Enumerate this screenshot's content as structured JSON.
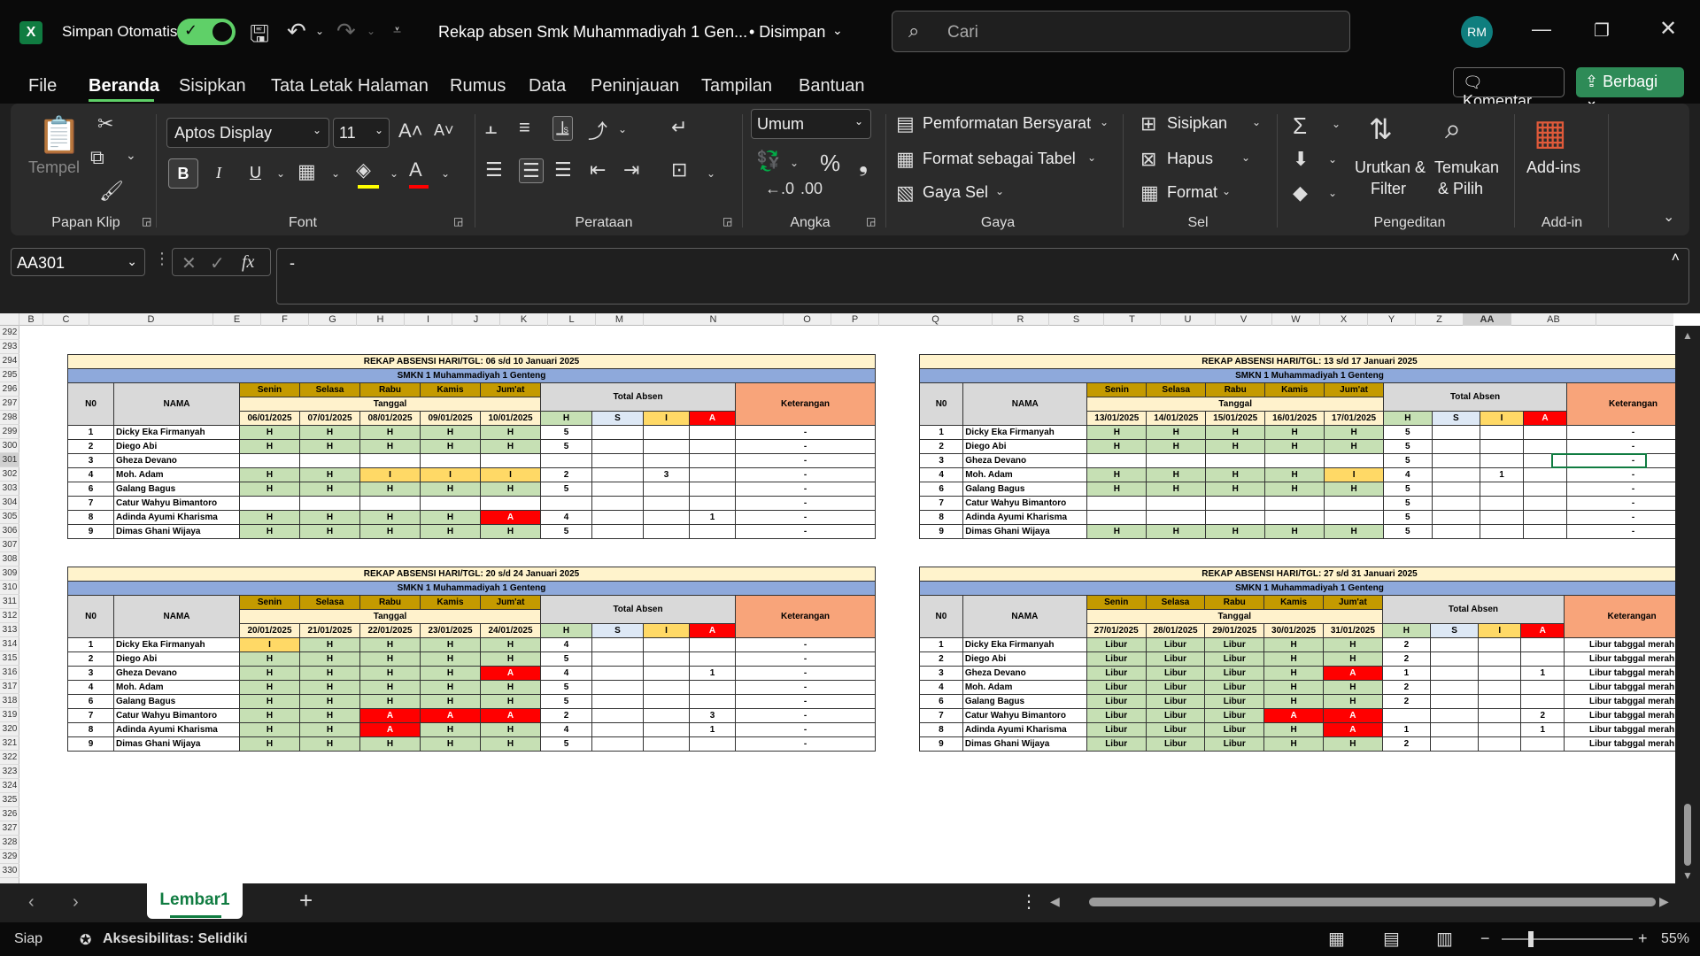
{
  "titlebar": {
    "autosave_label": "Simpan Otomatis",
    "doc_title": "Rekap absen Smk Muhammadiyah 1 Gen...",
    "saved_status": "• Disimpan",
    "search_placeholder": "Cari",
    "avatar_initials": "RM"
  },
  "menu": {
    "tabs": [
      "File",
      "Beranda",
      "Sisipkan",
      "Tata Letak Halaman",
      "Rumus",
      "Data",
      "Peninjauan",
      "Tampilan",
      "Bantuan"
    ],
    "comment_label": "Komentar",
    "share_label": "Berbagi"
  },
  "ribbon": {
    "clipboard": {
      "paste": "Tempel",
      "label": "Papan Klip"
    },
    "font": {
      "name": "Aptos Display",
      "size": "11",
      "label": "Font",
      "bold": "B",
      "italic": "I",
      "underline": "U"
    },
    "alignment": {
      "label": "Perataan"
    },
    "number": {
      "format": "Umum",
      "label": "Angka"
    },
    "styles": {
      "conditional": "Pemformatan Bersyarat",
      "format_table": "Format sebagai Tabel",
      "cell_styles": "Gaya Sel",
      "label": "Gaya"
    },
    "cells": {
      "insert": "Sisipkan",
      "delete": "Hapus",
      "format": "Format",
      "label": "Sel"
    },
    "editing": {
      "sort_filter_1": "Urutkan &",
      "sort_filter_2": "Filter",
      "find_1": "Temukan",
      "find_2": "& Pilih",
      "label": "Pengeditan"
    },
    "addins": {
      "button": "Add-ins",
      "label": "Add-in"
    }
  },
  "formula": {
    "namebox": "AA301",
    "content": "-"
  },
  "columns": [
    "B",
    "C",
    "D",
    "E",
    "F",
    "G",
    "H",
    "I",
    "J",
    "K",
    "L",
    "M",
    "N",
    "O",
    "P",
    "Q",
    "R",
    "S",
    "T",
    "U",
    "V",
    "W",
    "X",
    "Y",
    "Z",
    "AA",
    "AB"
  ],
  "rows": [
    "292",
    "293",
    "294",
    "295",
    "296",
    "297",
    "298",
    "299",
    "300",
    "301",
    "302",
    "303",
    "304",
    "305",
    "306",
    "307",
    "308",
    "309",
    "310",
    "311",
    "312",
    "313",
    "314",
    "315",
    "316",
    "317",
    "318",
    "319",
    "320",
    "321",
    "322",
    "323",
    "324",
    "325",
    "326",
    "327",
    "328",
    "329",
    "330"
  ],
  "tables": [
    {
      "title": "REKAP ABSENSI HARI/TGL: 06 s/d 10 Januari 2025",
      "school": "SMKN 1 Muhammadiyah 1 Genteng",
      "days": [
        "Senin",
        "Selasa",
        "Rabu",
        "Kamis",
        "Jum'at"
      ],
      "dates": [
        "06/01/2025",
        "07/01/2025",
        "08/01/2025",
        "09/01/2025",
        "10/01/2025"
      ],
      "rows": [
        {
          "no": "1",
          "name": "Dicky Eka Firmanyah",
          "att": [
            "H",
            "H",
            "H",
            "H",
            "H"
          ],
          "h": "5",
          "s": "",
          "i": "",
          "a": "",
          "ket": "-"
        },
        {
          "no": "2",
          "name": "Diego Abi",
          "att": [
            "H",
            "H",
            "H",
            "H",
            "H"
          ],
          "h": "5",
          "s": "",
          "i": "",
          "a": "",
          "ket": "-"
        },
        {
          "no": "3",
          "name": "Gheza Devano",
          "att": [
            "",
            "",
            "",
            "",
            ""
          ],
          "h": "",
          "s": "",
          "i": "",
          "a": "",
          "ket": "-"
        },
        {
          "no": "4",
          "name": "Moh. Adam",
          "att": [
            "H",
            "H",
            "I",
            "I",
            "I"
          ],
          "h": "2",
          "s": "",
          "i": "3",
          "a": "",
          "ket": "-"
        },
        {
          "no": "6",
          "name": "Galang Bagus",
          "att": [
            "H",
            "H",
            "H",
            "H",
            "H"
          ],
          "h": "5",
          "s": "",
          "i": "",
          "a": "",
          "ket": "-"
        },
        {
          "no": "7",
          "name": "Catur Wahyu Bimantoro",
          "att": [
            "",
            "",
            "",
            "",
            ""
          ],
          "h": "",
          "s": "",
          "i": "",
          "a": "",
          "ket": "-"
        },
        {
          "no": "8",
          "name": "Adinda Ayumi Kharisma",
          "att": [
            "H",
            "H",
            "H",
            "H",
            "A"
          ],
          "h": "4",
          "s": "",
          "i": "",
          "a": "1",
          "ket": "-"
        },
        {
          "no": "9",
          "name": "Dimas Ghani Wijaya",
          "att": [
            "H",
            "H",
            "H",
            "H",
            "H"
          ],
          "h": "5",
          "s": "",
          "i": "",
          "a": "",
          "ket": "-"
        }
      ]
    },
    {
      "title": "REKAP ABSENSI HARI/TGL: 13 s/d 17 Januari 2025",
      "school": "SMKN 1 Muhammadiyah 1 Genteng",
      "days": [
        "Senin",
        "Selasa",
        "Rabu",
        "Kamis",
        "Jum'at"
      ],
      "dates": [
        "13/01/2025",
        "14/01/2025",
        "15/01/2025",
        "16/01/2025",
        "17/01/2025"
      ],
      "rows": [
        {
          "no": "1",
          "name": "Dicky Eka Firmanyah",
          "att": [
            "H",
            "H",
            "H",
            "H",
            "H"
          ],
          "h": "5",
          "s": "",
          "i": "",
          "a": "",
          "ket": "-"
        },
        {
          "no": "2",
          "name": "Diego Abi",
          "att": [
            "H",
            "H",
            "H",
            "H",
            "H"
          ],
          "h": "5",
          "s": "",
          "i": "",
          "a": "",
          "ket": "-"
        },
        {
          "no": "3",
          "name": "Gheza Devano",
          "att": [
            "",
            "",
            "",
            "",
            ""
          ],
          "h": "5",
          "s": "",
          "i": "",
          "a": "",
          "ket": "-"
        },
        {
          "no": "4",
          "name": "Moh. Adam",
          "att": [
            "H",
            "H",
            "H",
            "H",
            "I"
          ],
          "h": "4",
          "s": "",
          "i": "1",
          "a": "",
          "ket": "-"
        },
        {
          "no": "6",
          "name": "Galang Bagus",
          "att": [
            "H",
            "H",
            "H",
            "H",
            "H"
          ],
          "h": "5",
          "s": "",
          "i": "",
          "a": "",
          "ket": "-"
        },
        {
          "no": "7",
          "name": "Catur Wahyu Bimantoro",
          "att": [
            "",
            "",
            "",
            "",
            ""
          ],
          "h": "5",
          "s": "",
          "i": "",
          "a": "",
          "ket": "-"
        },
        {
          "no": "8",
          "name": "Adinda Ayumi Kharisma",
          "att": [
            "",
            "",
            "",
            "",
            ""
          ],
          "h": "5",
          "s": "",
          "i": "",
          "a": "",
          "ket": "-"
        },
        {
          "no": "9",
          "name": "Dimas Ghani Wijaya",
          "att": [
            "H",
            "H",
            "H",
            "H",
            "H"
          ],
          "h": "5",
          "s": "",
          "i": "",
          "a": "",
          "ket": "-"
        }
      ]
    },
    {
      "title": "REKAP ABSENSI HARI/TGL: 20 s/d 24 Januari 2025",
      "school": "SMKN 1 Muhammadiyah 1 Genteng",
      "days": [
        "Senin",
        "Selasa",
        "Rabu",
        "Kamis",
        "Jum'at"
      ],
      "dates": [
        "20/01/2025",
        "21/01/2025",
        "22/01/2025",
        "23/01/2025",
        "24/01/2025"
      ],
      "rows": [
        {
          "no": "1",
          "name": "Dicky Eka Firmanyah",
          "att": [
            "I",
            "H",
            "H",
            "H",
            "H"
          ],
          "h": "4",
          "s": "",
          "i": "",
          "a": "",
          "ket": "-"
        },
        {
          "no": "2",
          "name": "Diego Abi",
          "att": [
            "H",
            "H",
            "H",
            "H",
            "H"
          ],
          "h": "5",
          "s": "",
          "i": "",
          "a": "",
          "ket": "-"
        },
        {
          "no": "3",
          "name": "Gheza Devano",
          "att": [
            "H",
            "H",
            "H",
            "H",
            "A"
          ],
          "h": "4",
          "s": "",
          "i": "",
          "a": "1",
          "ket": "-"
        },
        {
          "no": "4",
          "name": "Moh. Adam",
          "att": [
            "H",
            "H",
            "H",
            "H",
            "H"
          ],
          "h": "5",
          "s": "",
          "i": "",
          "a": "",
          "ket": "-"
        },
        {
          "no": "6",
          "name": "Galang Bagus",
          "att": [
            "H",
            "H",
            "H",
            "H",
            "H"
          ],
          "h": "5",
          "s": "",
          "i": "",
          "a": "",
          "ket": "-"
        },
        {
          "no": "7",
          "name": "Catur Wahyu Bimantoro",
          "att": [
            "H",
            "H",
            "A",
            "A",
            "A"
          ],
          "h": "2",
          "s": "",
          "i": "",
          "a": "3",
          "ket": "-"
        },
        {
          "no": "8",
          "name": "Adinda Ayumi Kharisma",
          "att": [
            "H",
            "H",
            "A",
            "H",
            "H"
          ],
          "h": "4",
          "s": "",
          "i": "",
          "a": "1",
          "ket": "-"
        },
        {
          "no": "9",
          "name": "Dimas Ghani Wijaya",
          "att": [
            "H",
            "H",
            "H",
            "H",
            "H"
          ],
          "h": "5",
          "s": "",
          "i": "",
          "a": "",
          "ket": "-"
        }
      ]
    },
    {
      "title": "REKAP ABSENSI HARI/TGL: 27 s/d 31 Januari 2025",
      "school": "SMKN 1 Muhammadiyah 1 Genteng",
      "days": [
        "Senin",
        "Selasa",
        "Rabu",
        "Kamis",
        "Jum'at"
      ],
      "dates": [
        "27/01/2025",
        "28/01/2025",
        "29/01/2025",
        "30/01/2025",
        "31/01/2025"
      ],
      "rows": [
        {
          "no": "1",
          "name": "Dicky Eka Firmanyah",
          "att": [
            "Libur",
            "Libur",
            "Libur",
            "H",
            "H"
          ],
          "h": "2",
          "s": "",
          "i": "",
          "a": "",
          "ket": "Libur tabggal merah"
        },
        {
          "no": "2",
          "name": "Diego Abi",
          "att": [
            "Libur",
            "Libur",
            "Libur",
            "H",
            "H"
          ],
          "h": "2",
          "s": "",
          "i": "",
          "a": "",
          "ket": "Libur tabggal merah"
        },
        {
          "no": "3",
          "name": "Gheza Devano",
          "att": [
            "Libur",
            "Libur",
            "Libur",
            "H",
            "A"
          ],
          "h": "1",
          "s": "",
          "i": "",
          "a": "1",
          "ket": "Libur tabggal merah"
        },
        {
          "no": "4",
          "name": "Moh. Adam",
          "att": [
            "Libur",
            "Libur",
            "Libur",
            "H",
            "H"
          ],
          "h": "2",
          "s": "",
          "i": "",
          "a": "",
          "ket": "Libur tabggal merah"
        },
        {
          "no": "6",
          "name": "Galang Bagus",
          "att": [
            "Libur",
            "Libur",
            "Libur",
            "H",
            "H"
          ],
          "h": "2",
          "s": "",
          "i": "",
          "a": "",
          "ket": "Libur tabggal merah"
        },
        {
          "no": "7",
          "name": "Catur Wahyu Bimantoro",
          "att": [
            "Libur",
            "Libur",
            "Libur",
            "A",
            "A"
          ],
          "h": "",
          "s": "",
          "i": "",
          "a": "2",
          "ket": "Libur tabggal merah"
        },
        {
          "no": "8",
          "name": "Adinda Ayumi Kharisma",
          "att": [
            "Libur",
            "Libur",
            "Libur",
            "H",
            "A"
          ],
          "h": "1",
          "s": "",
          "i": "",
          "a": "1",
          "ket": "Libur tabggal merah"
        },
        {
          "no": "9",
          "name": "Dimas Ghani Wijaya",
          "att": [
            "Libur",
            "Libur",
            "Libur",
            "H",
            "H"
          ],
          "h": "2",
          "s": "",
          "i": "",
          "a": "",
          "ket": "Libur tabggal merah"
        }
      ]
    }
  ],
  "labels": {
    "no": "N0",
    "nama": "NAMA",
    "tanggal": "Tanggal",
    "total": "Total Absen",
    "ket": "Keterangan",
    "h": "H",
    "s": "S",
    "i": "I",
    "a": "A"
  },
  "sheet_tab": "Lembar1",
  "status": {
    "ready": "Siap",
    "accessibility": "Aksesibilitas: Selidiki",
    "zoom": "55%"
  }
}
